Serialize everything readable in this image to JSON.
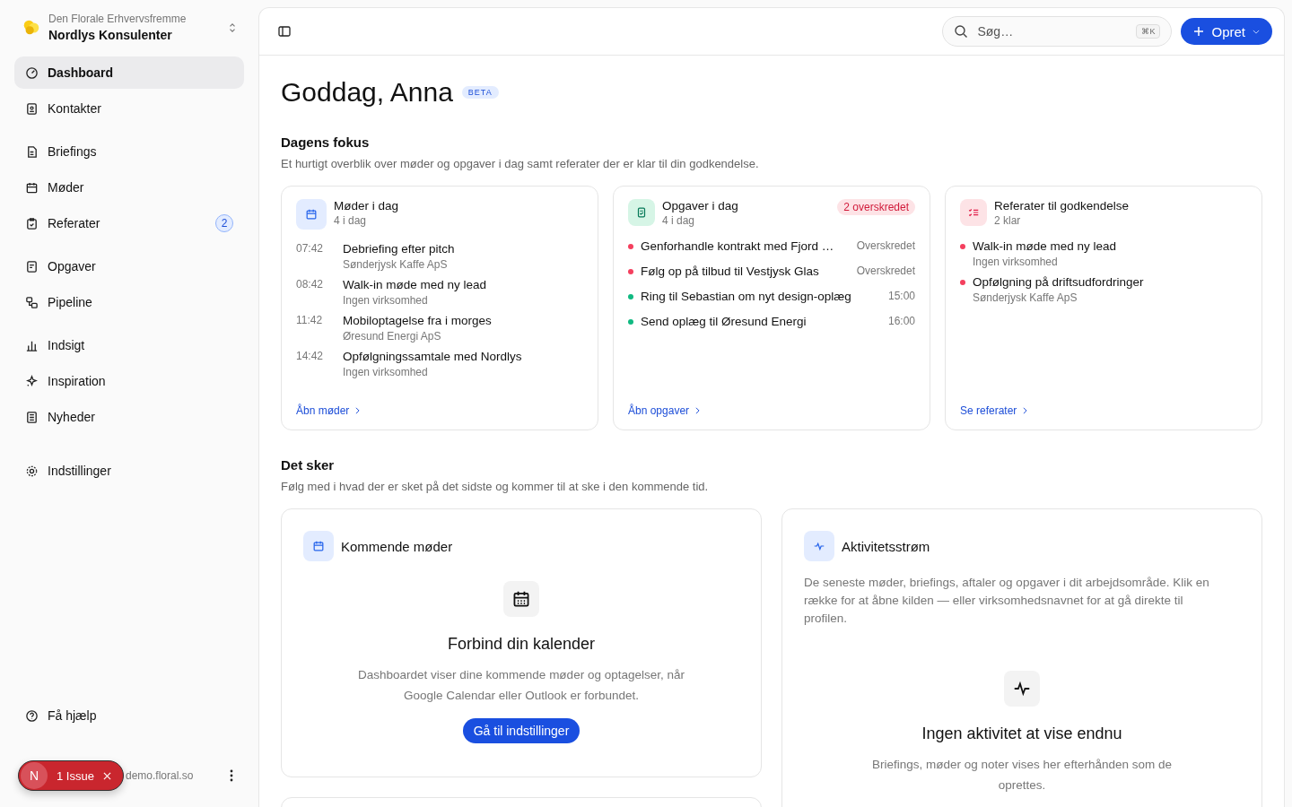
{
  "workspace": {
    "org": "Den Florale Erhvervsfremme",
    "name": "Nordlys Konsulenter"
  },
  "nav_groups": [
    [
      {
        "label": "Dashboard",
        "selected": true
      },
      {
        "label": "Kontakter",
        "selected": false
      }
    ],
    [
      {
        "label": "Briefings",
        "selected": false
      },
      {
        "label": "Møder",
        "selected": false
      },
      {
        "label": "Referater",
        "selected": false,
        "badge": "2"
      }
    ],
    [
      {
        "label": "Opgaver",
        "selected": false
      },
      {
        "label": "Pipeline",
        "selected": false
      }
    ],
    [
      {
        "label": "Indsigt",
        "selected": false
      },
      {
        "label": "Inspiration",
        "selected": false
      },
      {
        "label": "Nyheder",
        "selected": false
      }
    ],
    [
      {
        "label": "Indstillinger",
        "selected": false
      }
    ]
  ],
  "help": {
    "label": "Få hjælp"
  },
  "user": {
    "email": "demo.floral.so"
  },
  "issue_badge": {
    "letter": "N",
    "label": "1 Issue"
  },
  "search": {
    "placeholder": "Søg…",
    "shortcut": "⌘K"
  },
  "create_button": {
    "label": "Opret"
  },
  "greeting": {
    "title": "Goddag, Anna",
    "badge": "BETA"
  },
  "focus": {
    "title": "Dagens fokus",
    "subtitle": "Et hurtigt overblik over møder og opgaver i dag samt referater der er klar til din godkendelse.",
    "cards": [
      {
        "kind": "meetings",
        "title": "Møder i dag",
        "count": "4 i dag",
        "link": "Åbn møder",
        "items": [
          {
            "time": "07:42",
            "title": "Debriefing efter pitch",
            "company": "Sønderjysk Kaffe ApS"
          },
          {
            "time": "08:42",
            "title": "Walk-in møde med ny lead",
            "company": "Ingen virksomhed"
          },
          {
            "time": "11:42",
            "title": "Mobiloptagelse fra i morges",
            "company": "Øresund Energi ApS"
          },
          {
            "time": "14:42",
            "title": "Opfølgningssamtale med Nordlys",
            "company": "Ingen virksomhed"
          }
        ]
      },
      {
        "kind": "tasks",
        "title": "Opgaver i dag",
        "count": "4 i dag",
        "tag": "2 overskredet",
        "link": "Åbn opgaver",
        "items": [
          {
            "title": "Genforhandle kontrakt med Fjord …",
            "due": "Overskredet",
            "color": "#f43f5e"
          },
          {
            "title": "Følg op på tilbud til Vestjysk Glas",
            "due": "Overskredet",
            "color": "#f43f5e"
          },
          {
            "title": "Ring til Sebastian om nyt design-oplæg",
            "due": "15:00",
            "color": "#10b981"
          },
          {
            "title": "Send oplæg til Øresund Energi",
            "due": "16:00",
            "color": "#10b981"
          }
        ]
      },
      {
        "kind": "minutes",
        "title": "Referater til godkendelse",
        "count": "2 klar",
        "link": "Se referater",
        "items": [
          {
            "title": "Walk-in møde med ny lead",
            "company": "Ingen virksomhed",
            "color": "#f43f5e"
          },
          {
            "title": "Opfølgning på driftsudfordringer",
            "company": "Sønderjysk Kaffe ApS",
            "color": "#f43f5e"
          }
        ]
      }
    ]
  },
  "happening": {
    "title": "Det sker",
    "subtitle": "Følg med i hvad der er sket på det sidste og kommer til at ske i den kommende tid.",
    "upcoming": {
      "title": "Kommende møder",
      "empty_title": "Forbind din kalender",
      "empty_text": "Dashboardet viser dine kommende møder og optagelser, når Google Calendar eller Outlook er forbundet.",
      "button": "Gå til indstillinger"
    },
    "activity": {
      "title": "Aktivitetsstrøm",
      "description": "De seneste møder, briefings, aftaler og opgaver i dit arbejdsområde. Klik en række for at åbne kilden — eller virksomhedsnavnet for at gå direkte til profilen.",
      "empty_title": "Ingen aktivitet at vise endnu",
      "empty_text": "Briefings, møder og noter vises her efterhånden som de oprettes."
    }
  }
}
